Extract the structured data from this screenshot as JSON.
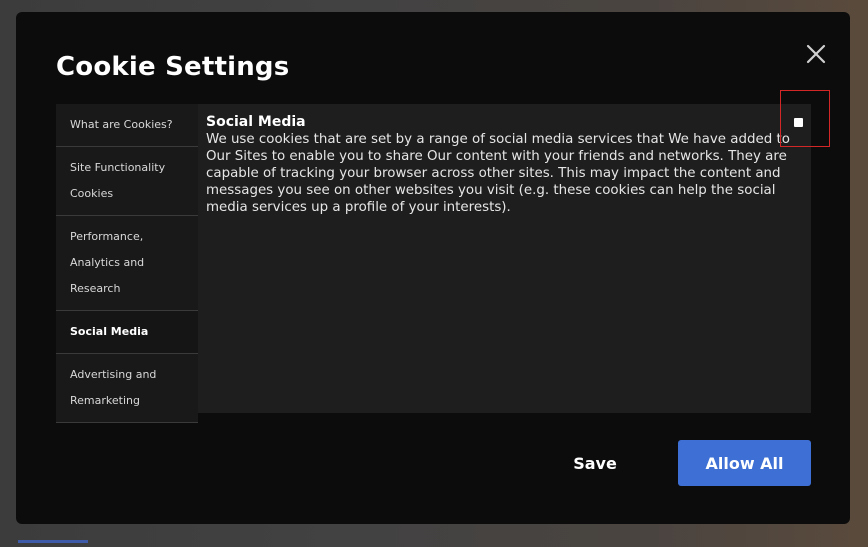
{
  "modal": {
    "title": "Cookie Settings",
    "close_icon": "close-icon"
  },
  "categories": [
    {
      "label": "What are Cookies?",
      "active": false
    },
    {
      "label": "Site Functionality Cookies",
      "active": false
    },
    {
      "label": "Performance, Analytics and Research",
      "active": false
    },
    {
      "label": "Social Media",
      "active": true
    },
    {
      "label": "Advertising and Remarketing",
      "active": false
    }
  ],
  "detail": {
    "heading": "Social Media",
    "body": "We use cookies that are set by a range of social media services that We have added to Our Sites to enable you to share Our content with your friends and networks. They are capable of tracking your browser across other sites. This may impact the content and messages you see on other websites you visit (e.g. these cookies can help the social media services up a profile of your interests).",
    "toggle_checked": false
  },
  "buttons": {
    "save_label": "Save",
    "allow_all_label": "Allow All"
  },
  "colors": {
    "modal_bg": "#0c0c0c",
    "panel_bg": "#1e1e1e",
    "accent": "#3d6fd4",
    "highlight_border": "#d32626"
  }
}
